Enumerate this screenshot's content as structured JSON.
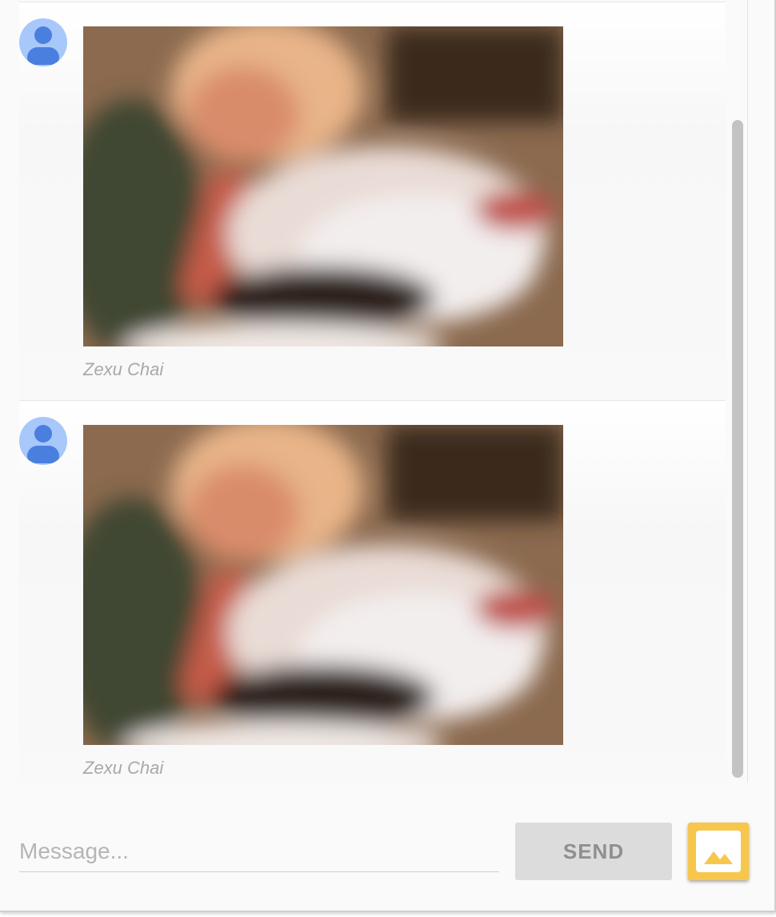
{
  "messages": [
    {
      "author": "Zexu Chai",
      "avatar_icon": "default-user-icon",
      "image_alt": "blurred photo"
    },
    {
      "author": "Zexu Chai",
      "avatar_icon": "default-user-icon",
      "image_alt": "blurred photo"
    }
  ],
  "composer": {
    "placeholder": "Message...",
    "value": "",
    "send_label": "SEND",
    "image_button_icon": "image-icon"
  },
  "colors": {
    "avatar_bg": "#a8c7fa",
    "avatar_fg": "#4a7fe0",
    "send_bg": "#dcdcdc",
    "image_button_bg": "#f7c74d"
  }
}
